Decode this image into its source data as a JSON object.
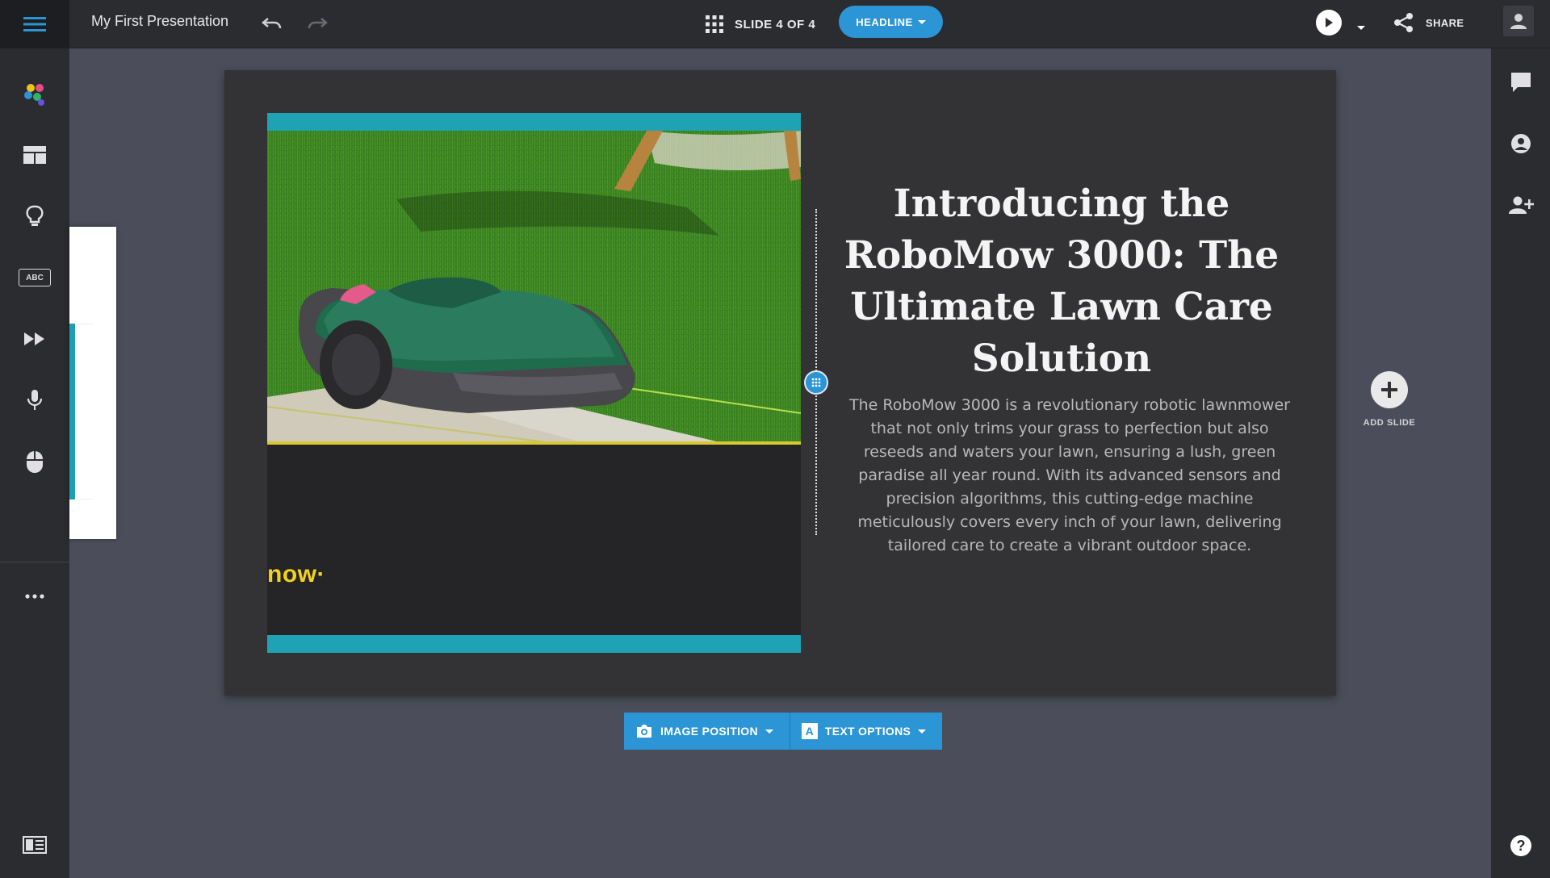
{
  "app": {
    "title": "My First Presentation",
    "slide_counter": "SLIDE 4 OF 4",
    "layout_button": "HEADLINE",
    "share_label": "SHARE"
  },
  "left_sidebar": {
    "items": [
      {
        "name": "theme-icon"
      },
      {
        "name": "layout-icon"
      },
      {
        "name": "ideas-icon"
      },
      {
        "name": "text-style-icon",
        "label": "ABC"
      },
      {
        "name": "transitions-icon"
      },
      {
        "name": "narration-icon"
      },
      {
        "name": "interactivity-icon"
      },
      {
        "name": "more-icon"
      },
      {
        "name": "slide-list-icon"
      }
    ]
  },
  "right_sidebar": {
    "items": [
      {
        "name": "comments-icon"
      },
      {
        "name": "account-icon"
      },
      {
        "name": "invite-collaborator-icon"
      },
      {
        "name": "help-icon",
        "label": "?"
      }
    ]
  },
  "slide": {
    "title": "Introducing the RoboMow 3000: The Ultimate Lawn Care Solution",
    "body": "The RoboMow 3000 is a revolutionary robotic lawnmower that not only trims your grass to perfection but also reseeds and waters your lawn, ensuring a lush, green paradise all year round. With its advanced sensors and precision algorithms, this cutting-edge machine meticulously covers every inch of your lawn, delivering tailored care to create a vibrant outdoor space.",
    "image_brand_text": "now·"
  },
  "add_slide_label": "ADD SLIDE",
  "bottom_toolbar": {
    "image_position": "IMAGE POSITION",
    "text_options": "TEXT OPTIONS",
    "text_icon_letter": "A"
  },
  "colors": {
    "accent": "#2b95d6",
    "teal": "#1fa3b4",
    "brand_yellow": "#f2d21a",
    "panel": "#2b2c30",
    "canvas": "#4b4e5a",
    "slide_bg": "#333336"
  }
}
